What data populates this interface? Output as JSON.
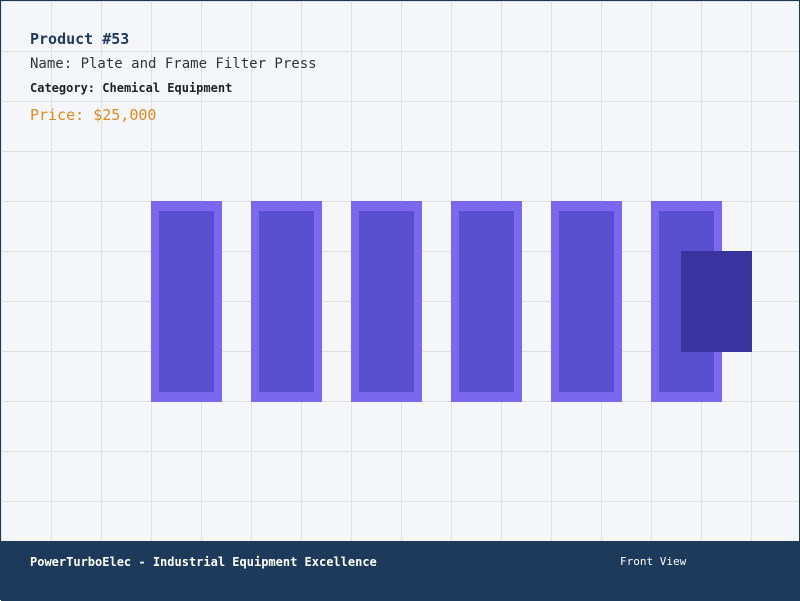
{
  "product": {
    "title": "Product #53",
    "name_line": "Name: Plate and Frame Filter Press",
    "category_label": "Category:",
    "category_value": "Chemical Equipment",
    "price_line": "Price: $25,000"
  },
  "illustration": {
    "plate_count": 6,
    "colors": {
      "plate_outer": "#7b68ee",
      "plate_inner": "#5a4fcf",
      "end_block": "#3b34a0",
      "background": "#f5f6fa",
      "grid": "#dfe1e7"
    }
  },
  "footer": {
    "brand": "PowerTurboElec - Industrial Equipment Excellence",
    "view": "Front View",
    "background_color": "#1e3a5a"
  },
  "colors": {
    "price": "#e08a1e",
    "title": "#1e3a5a"
  }
}
